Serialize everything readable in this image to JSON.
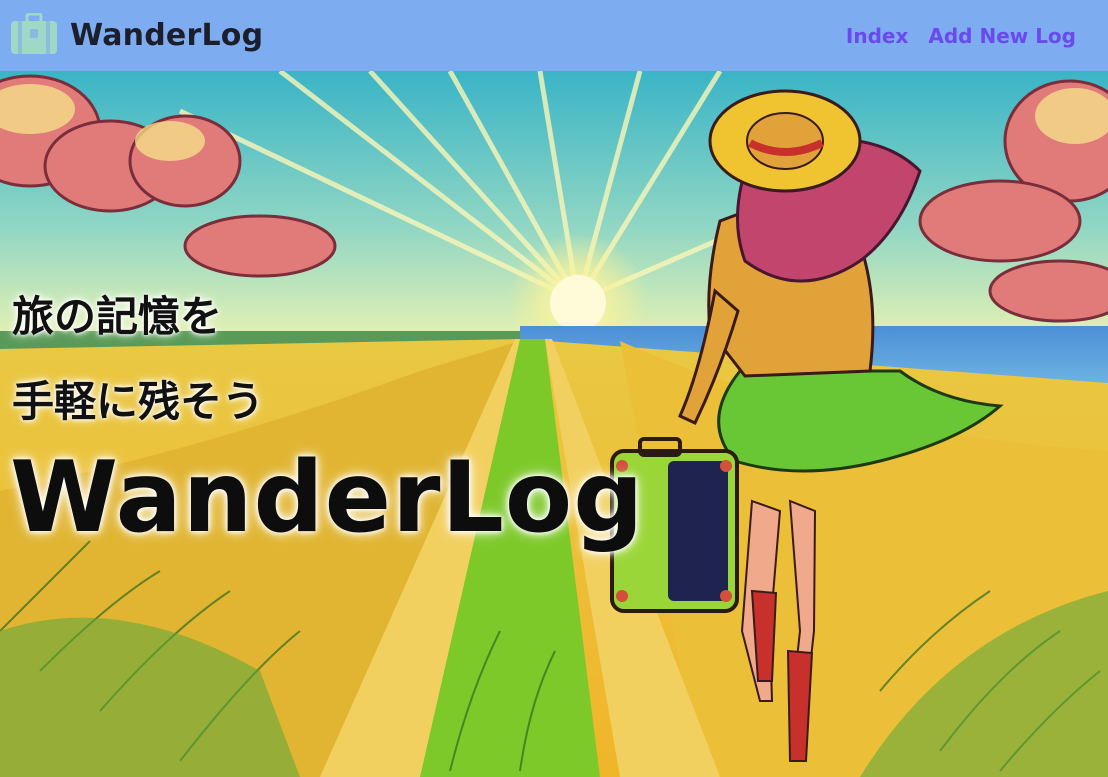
{
  "brand": {
    "name": "WanderLog",
    "logo_icon": "suitcase-icon"
  },
  "nav": {
    "links": [
      {
        "label": "Index"
      },
      {
        "label": "Add New Log"
      }
    ]
  },
  "hero": {
    "tagline_line1": "旅の記憶を",
    "tagline_line2": "手軽に残そう",
    "title": "WanderLog",
    "image": "illustration of a woman with a hat and suitcase walking down a path through a wheat field toward a sunset by the sea"
  },
  "colors": {
    "navbar": "#7eacf0",
    "nav_link": "#6a49ee",
    "logo": "#9fd8c6",
    "text": "#1c1f2b"
  }
}
